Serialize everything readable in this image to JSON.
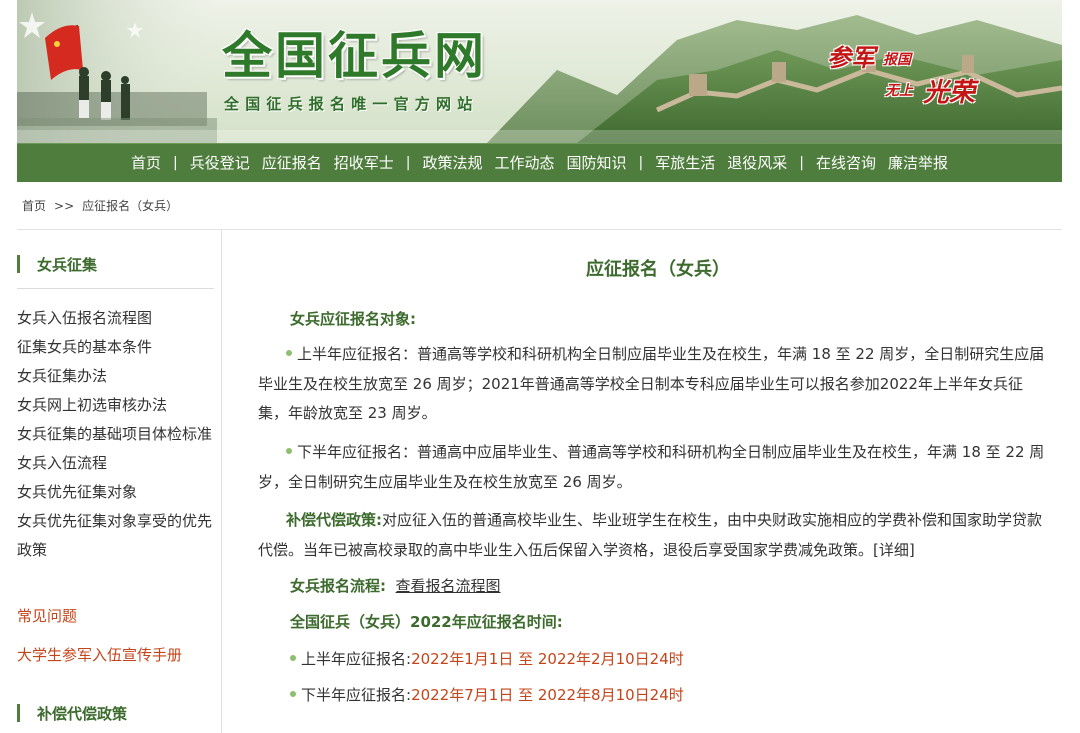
{
  "banner": {
    "site_title": "全国征兵网",
    "site_subtitle": "全国征兵报名唯一官方网站",
    "slogan": {
      "a": "参军",
      "b": "报国",
      "c": "无上",
      "d": "光荣"
    }
  },
  "nav": {
    "items": [
      "首页",
      "兵役登记",
      "应征报名",
      "招收军士",
      "政策法规",
      "工作动态",
      "国防知识",
      "军旅生活",
      "退役风采",
      "在线咨询",
      "廉洁举报"
    ],
    "separator": "|"
  },
  "breadcrumb": {
    "home": "首页",
    "sep": ">>",
    "current": "应征报名（女兵）"
  },
  "sidebar": {
    "section1_title": "女兵征集",
    "items": [
      "女兵入伍报名流程图",
      "征集女兵的基本条件",
      "女兵征集办法",
      "女兵网上初选审核办法",
      "女兵征集的基础项目体检标准",
      "女兵入伍流程",
      "女兵优先征集对象",
      "女兵优先征集对象享受的优先政策"
    ],
    "faq": "常见问题",
    "handbook": "大学生参军入伍宣传手册",
    "section2_title": "补偿代偿政策"
  },
  "main": {
    "title": "应征报名（女兵）",
    "target_head": "女兵应征报名对象:",
    "first_half_text": "上半年应征报名：普通高等学校和科研机构全日制应届毕业生及在校生，年满 18 至 22 周岁，全日制研究生应届毕业生及在校生放宽至 26 周岁；2021年普通高等学校全日制本专科应届毕业生可以报名参加2022年上半年女兵征集，年龄放宽至 23 周岁。",
    "second_half_text": "下半年应征报名：普通高中应届毕业生、普通高等学校和科研机构全日制应届毕业生及在校生，年满 18 至 22 周岁，全日制研究生应届毕业生及在校生放宽至 26 周岁。",
    "compensation_label": "补偿代偿政策:",
    "compensation_text": "对应征入伍的普通高校毕业生、毕业班学生在校生，由中央财政实施相应的学费补偿和国家助学贷款代偿。当年已被高校录取的高中毕业生入伍后保留入学资格，退役后享受国家学费减免政策。",
    "detail_link": "[详细]",
    "process_label": "女兵报名流程:",
    "process_link": "查看报名流程图",
    "time_head": "全国征兵（女兵）2022年应征报名时间:",
    "first_half_label": "上半年应征报名:",
    "first_half_time": "2022年1月1日 至 2022年2月10日24时",
    "second_half_label": "下半年应征报名:",
    "second_half_time": "2022年7月1日 至 2022年8月10日24时"
  },
  "colors": {
    "nav_green": "#4f7d3d",
    "heading_green": "#3d6b2e",
    "accent_red": "#c4451a",
    "bullet_green": "#8cbf6e"
  }
}
